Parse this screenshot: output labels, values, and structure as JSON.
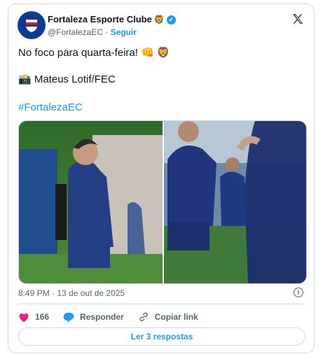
{
  "header": {
    "display_name": "Fortaleza Esporte Clube",
    "name_emoji": "🦁",
    "handle": "@FortalezaEC",
    "separator": "·",
    "follow_label": "Seguir",
    "platform_icon": "x-logo-icon",
    "avatar_icon": "fortaleza-crest-icon"
  },
  "post": {
    "line1": "No foco para quarta-feira! 👊 🦁",
    "line2": "📸 Mateus Lotif/FEC",
    "hashtag": "#FortalezaEC"
  },
  "media": {
    "photos": [
      "player-training-photo-left",
      "players-training-photo-right"
    ]
  },
  "meta": {
    "timestamp": "8:49 PM · 13 de out de 2025"
  },
  "actions": {
    "likes_count": "166",
    "reply_label": "Responder",
    "copy_link_label": "Copiar link"
  },
  "footer": {
    "read_replies_label": "Ler 3 respostas"
  },
  "colors": {
    "accent": "#1d9bf0",
    "like": "#f91880",
    "text": "#0f1419",
    "muted": "#536471",
    "border": "#cfd9de",
    "club_blue": "#0a3d8f"
  }
}
